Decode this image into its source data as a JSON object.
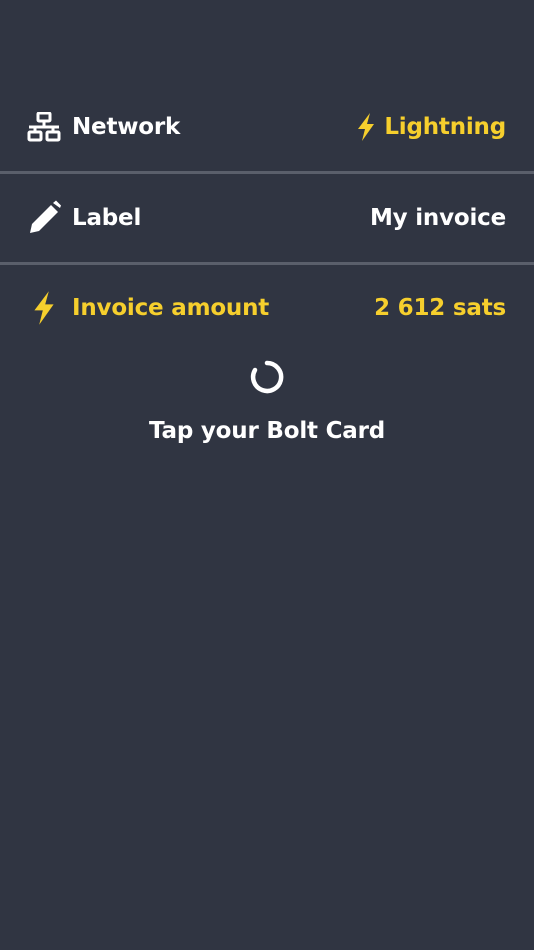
{
  "rows": {
    "network": {
      "label": "Network",
      "icon": "network-icon",
      "value": "Lightning",
      "value_icon": "lightning-bolt-icon"
    },
    "label": {
      "label": "Label",
      "icon": "pencil-icon",
      "value": "My invoice"
    },
    "amount": {
      "label": "Invoice amount",
      "icon": "lightning-bolt-icon",
      "value": "2 612 sats"
    }
  },
  "status": {
    "spinner_icon": "loading-spinner-icon",
    "message": "Tap your Bolt Card"
  },
  "colors": {
    "background": "#303542",
    "accent": "#f6cf2d",
    "text": "#ffffff",
    "divider": "#5a5f6b"
  }
}
